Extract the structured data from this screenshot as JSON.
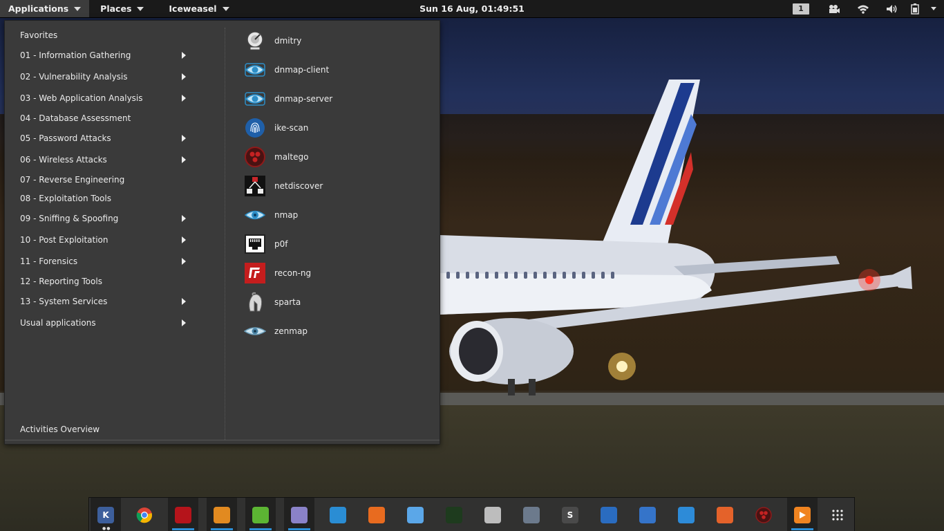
{
  "topbar": {
    "menus": [
      {
        "label": "Applications"
      },
      {
        "label": "Places"
      },
      {
        "label": "Iceweasel"
      }
    ],
    "clock": "Sun 16 Aug, 01:49:51",
    "workspace": "1",
    "tray_icons": [
      "workspace-indicator",
      "camera-icon",
      "wifi-icon",
      "volume-icon",
      "battery-icon",
      "power-icon"
    ]
  },
  "menu": {
    "categories": [
      {
        "label": "Favorites",
        "submenu": false
      },
      {
        "label": "01 - Information Gathering",
        "submenu": true
      },
      {
        "label": "02 - Vulnerability Analysis",
        "submenu": true
      },
      {
        "label": "03 - Web Application Analysis",
        "submenu": true
      },
      {
        "label": "04 - Database Assessment",
        "submenu": false
      },
      {
        "label": "05 - Password Attacks",
        "submenu": true
      },
      {
        "label": "06 - Wireless Attacks",
        "submenu": true
      },
      {
        "label": "07 - Reverse Engineering",
        "submenu": false
      },
      {
        "label": "08 - Exploitation Tools",
        "submenu": false
      },
      {
        "label": "09 - Sniffing & Spoofing",
        "submenu": true
      },
      {
        "label": "10 - Post Exploitation",
        "submenu": true
      },
      {
        "label": "11 - Forensics",
        "submenu": true
      },
      {
        "label": "12 - Reporting Tools",
        "submenu": false
      },
      {
        "label": "13 - System Services",
        "submenu": true
      },
      {
        "label": "Usual applications",
        "submenu": true
      }
    ],
    "activities_label": "Activities Overview",
    "apps": [
      {
        "label": "dmitry",
        "icon": "satellite-dish-icon"
      },
      {
        "label": "dnmap-client",
        "icon": "eye-arrows-icon"
      },
      {
        "label": "dnmap-server",
        "icon": "eye-arrows-icon"
      },
      {
        "label": "ike-scan",
        "icon": "fingerprint-icon"
      },
      {
        "label": "maltego",
        "icon": "maltego-icon"
      },
      {
        "label": "netdiscover",
        "icon": "network-icon"
      },
      {
        "label": "nmap",
        "icon": "eye-icon"
      },
      {
        "label": "p0f",
        "icon": "ethernet-port-icon"
      },
      {
        "label": "recon-ng",
        "icon": "recon-icon"
      },
      {
        "label": "sparta",
        "icon": "spartan-helmet-icon"
      },
      {
        "label": "zenmap",
        "icon": "eye-icon"
      }
    ]
  },
  "dock": {
    "items": [
      {
        "name": "kali-icon",
        "color": "#3d5f9c",
        "glyph": "K",
        "running": true,
        "dots": true
      },
      {
        "name": "chrome-icon",
        "color": "#e0a21f",
        "glyph": "",
        "running": false
      },
      {
        "name": "armitage-icon",
        "color": "#b5141b",
        "glyph": "",
        "running": true
      },
      {
        "name": "files-icon",
        "color": "#e28a20",
        "glyph": "",
        "running": true
      },
      {
        "name": "leafpad-icon",
        "color": "#5cb533",
        "glyph": "",
        "running": true
      },
      {
        "name": "text-editor-icon",
        "color": "#8a82c8",
        "glyph": "",
        "running": true
      },
      {
        "name": "system-monitor-icon",
        "color": "#2a8dd4",
        "glyph": "",
        "running": false
      },
      {
        "name": "burpsuite-icon",
        "color": "#e86b1f",
        "glyph": "",
        "running": false
      },
      {
        "name": "iceweasel-icon",
        "color": "#5ba7e8",
        "glyph": "",
        "running": false
      },
      {
        "name": "activity-monitor-icon",
        "color": "#1e3b1e",
        "glyph": "",
        "running": false
      },
      {
        "name": "calculator-icon",
        "color": "#bdbdbd",
        "glyph": "",
        "running": false
      },
      {
        "name": "wireshark-icon",
        "color": "#6c7a8c",
        "glyph": "",
        "running": false
      },
      {
        "name": "sublime-icon",
        "color": "#4a4a4a",
        "glyph": "S",
        "running": false
      },
      {
        "name": "gns3-icon",
        "color": "#2a6cc0",
        "glyph": "",
        "running": false
      },
      {
        "name": "screenshot-icon",
        "color": "#3574c9",
        "glyph": "",
        "running": false
      },
      {
        "name": "oscilloscope-icon",
        "color": "#2d8bd8",
        "glyph": "",
        "running": false
      },
      {
        "name": "burp-icon",
        "color": "#e4622a",
        "glyph": "",
        "running": false
      },
      {
        "name": "maltego-dock-icon",
        "color": "#8d1d1d",
        "glyph": "",
        "running": false
      },
      {
        "name": "media-player-icon",
        "color": "#f08420",
        "glyph": "",
        "running": true
      },
      {
        "name": "show-apps-icon",
        "color": "#333333",
        "glyph": "",
        "running": false
      }
    ]
  }
}
